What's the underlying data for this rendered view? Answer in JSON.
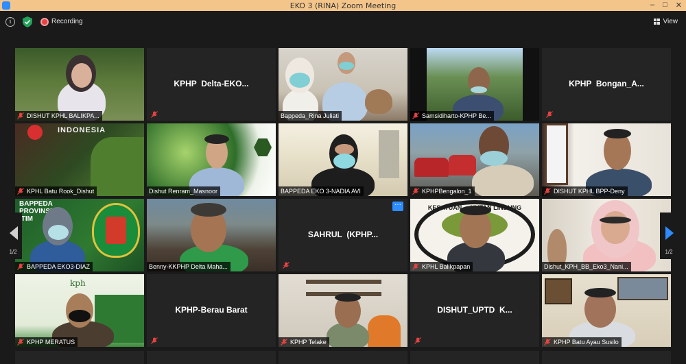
{
  "window": {
    "title": "EKO 3 (RINA)   Zoom Meeting"
  },
  "topbar": {
    "recording_label": "Recording",
    "view_label": "View"
  },
  "colors": {
    "accent": "#2d8cff",
    "active_speaker": "#d7e85a",
    "recording": "#e84242",
    "titlebar": "#f3c58a"
  },
  "pagination": {
    "left_page": "1/2",
    "right_page": "1/2"
  },
  "tiles": [
    {
      "name": "DISHUT KPHL BALIKPA...",
      "video": true,
      "muted": true
    },
    {
      "name": "KPHP  Delta-EKO...",
      "video": false,
      "muted": true
    },
    {
      "name": "Bappeda_Rina Juliati",
      "video": true,
      "muted": false
    },
    {
      "name": "Samsidiharto-KPHP Be...",
      "video": true,
      "muted": true
    },
    {
      "name": "KPHP  Bongan_A...",
      "video": false,
      "muted": true
    },
    {
      "name": "KPHL Batu Rook_Dishut",
      "video": true,
      "muted": true,
      "overlay_text": "INDONESIA"
    },
    {
      "name": "Dishut Renram_Masnoor",
      "video": true,
      "muted": false
    },
    {
      "name": "BAPPEDA EKO 3-NADIA AVI",
      "video": true,
      "muted": false,
      "active": true
    },
    {
      "name": "KPHPBengalon_1",
      "video": true,
      "muted": true
    },
    {
      "name": "DISHUT KPHL BPP-Deny",
      "video": true,
      "muted": true
    },
    {
      "name": "BAPPEDA EKO3-DIAZ",
      "video": true,
      "muted": true,
      "overlay_text": "BAPPEDA\nPROVINSI\n.TIM"
    },
    {
      "name": "Benny-KKPHP Delta Maha...",
      "video": true,
      "muted": false
    },
    {
      "name": "SAHRUL  (KPHP...",
      "video": false,
      "muted": true,
      "more_menu": "···"
    },
    {
      "name": "KPHL Balikpapan",
      "video": true,
      "muted": true,
      "overlay_text": "KESATUAN ... HUTAN LINDUNG"
    },
    {
      "name": "Dishut_KPH_BB_Eko3_Nani...",
      "video": true,
      "muted": false
    },
    {
      "name": "KPHP MERATUS",
      "video": true,
      "muted": true,
      "overlay_text": "kph"
    },
    {
      "name": "KPHP-Berau Barat",
      "video": false,
      "muted": true
    },
    {
      "name": "KPHP Telake",
      "video": true,
      "muted": true
    },
    {
      "name": "DISHUT_UPTD  K...",
      "video": false,
      "muted": true
    },
    {
      "name": "KPHP Batu Ayau Susilo",
      "video": true,
      "muted": true
    }
  ]
}
